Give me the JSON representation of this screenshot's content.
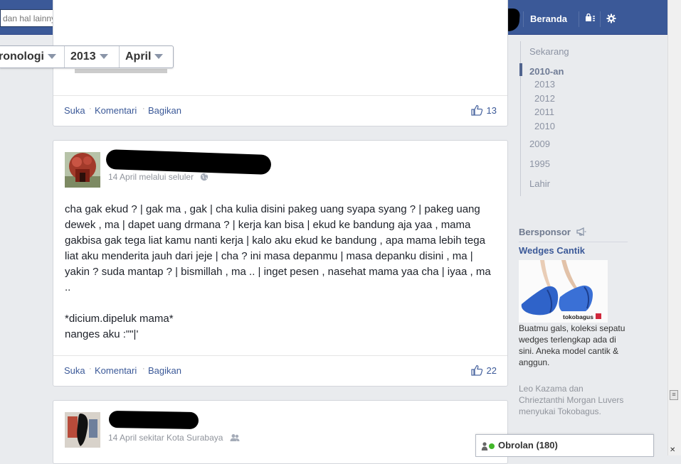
{
  "search": {
    "placeholder": "dan hal lainnya"
  },
  "nav": {
    "home_label": "Beranda"
  },
  "chrono": {
    "items": [
      "ronologi",
      "2013",
      "April"
    ]
  },
  "posts": [
    {
      "actions": [
        "Suka",
        "Komentari",
        "Bagikan"
      ],
      "likes": "13"
    },
    {
      "meta": "14 April melalui seluler",
      "text": "cha gak ekud ? | gak ma , gak | cha kulia disini pakeg uang syapa syang ? | pakeg uang dewek , ma | dapet uang drmana ? | kerja kan bisa | ekud ke bandung aja yaa , mama gakbisa gak tega liat kamu nanti kerja | kalo aku ekud ke bandung , apa mama lebih tega liat aku menderita jauh dari jeje | cha ? ini masa depanmu | masa depanku disini , ma | yakin ? suda mantap ? | bismillah , ma .. | inget pesen , nasehat mama yaa cha | iyaa , ma ..\n\n*dicium.dipeluk mama*\nnanges aku :\"\"|'",
      "actions": [
        "Suka",
        "Komentari",
        "Bagikan"
      ],
      "likes": "22"
    },
    {
      "meta": "14 April sekitar Kota Surabaya"
    }
  ],
  "timeline": {
    "items": [
      "Sekarang",
      "2010-an",
      "2013",
      "2012",
      "2011",
      "2010",
      "2009",
      "1995",
      "Lahir"
    ]
  },
  "sponsored": {
    "heading": "Bersponsor",
    "ad_title": "Wedges Cantik",
    "ad_brand": "tokobagus",
    "ad_body": "Buatmu gals, koleksi sepatu wedges terlengkap ada di sini. Aneka model cantik & anggun.",
    "ad_social": "Leo Kazama dan Chrieztanthi Morgan Luvers menyukai Tokobagus."
  },
  "chat": {
    "label": "Obrolan (180)"
  },
  "colors": {
    "brand": "#3b5998",
    "link": "#3b5998",
    "meta": "#90949c",
    "online": "#42b72a"
  }
}
